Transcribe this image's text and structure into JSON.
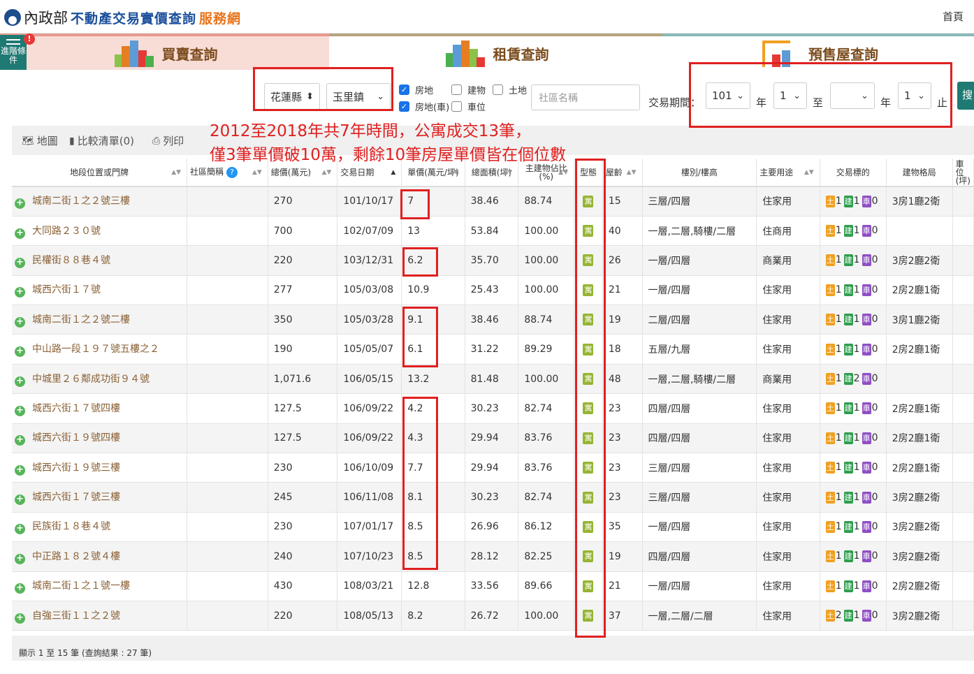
{
  "header": {
    "ministry": "內政部",
    "site_title": "不動產交易實價查詢",
    "site_suffix": "服務網",
    "home_link": "首頁"
  },
  "tabs": [
    {
      "label": "買賣查詢",
      "active": true
    },
    {
      "label": "租賃查詢",
      "active": false
    },
    {
      "label": "預售屋查詢",
      "active": false
    }
  ],
  "advanced": {
    "label": "進階條件",
    "badge": "!"
  },
  "filters": {
    "county": "花蓮縣",
    "town": "玉里鎮",
    "checkboxes": [
      {
        "label": "房地",
        "checked": true
      },
      {
        "label": "建物",
        "checked": false
      },
      {
        "label": "土地",
        "checked": false
      },
      {
        "label": "房地(車)",
        "checked": true
      },
      {
        "label": "車位",
        "checked": false
      }
    ],
    "community_placeholder": "社區名稱",
    "period_label": "交易期間：",
    "start_year": "101",
    "start_month": "1",
    "end_year": "",
    "end_month": "1",
    "year_unit": "年",
    "to_label": "至",
    "end_label": "止",
    "search_label": "搜"
  },
  "annotation": {
    "line1": "2012至2018年共7年時間，公寓成交13筆，",
    "line2": "僅3筆單價破10萬，剩餘10筆房屋單價皆在個位數"
  },
  "toolbar": {
    "map_label": "地圖",
    "compare_label": "比較清單(0)",
    "print_label": "列印"
  },
  "table": {
    "headers": [
      "地段位置或門牌",
      "社區簡稱",
      "總價(萬元)",
      "交易日期",
      "單價(萬元/坪)",
      "總面積(坪)",
      "主建物佔比(%)",
      "型態",
      "屋齡",
      "樓別/樓高",
      "主要用途",
      "交易標的",
      "建物格局",
      "車位(坪)"
    ],
    "type_tag": "寓",
    "tag_labels": {
      "land": "土",
      "building": "建",
      "car": "車"
    },
    "rows": [
      {
        "addr": "城南二街１之２號三樓",
        "price": "270",
        "date": "101/10/17",
        "unit": "7",
        "area": "38.46",
        "ratio": "88.74",
        "age": "15",
        "floor": "三層/四層",
        "use": "住家用",
        "land": "1",
        "bldg": "1",
        "car": "0",
        "layout": "3房1廳2衛"
      },
      {
        "addr": "大同路２３０號",
        "price": "700",
        "date": "102/07/09",
        "unit": "13",
        "area": "53.84",
        "ratio": "100.00",
        "age": "40",
        "floor": "一層,二層,騎樓/二層",
        "use": "住商用",
        "land": "1",
        "bldg": "1",
        "car": "0",
        "layout": ""
      },
      {
        "addr": "民權街８８巷４號",
        "price": "220",
        "date": "103/12/31",
        "unit": "6.2",
        "area": "35.70",
        "ratio": "100.00",
        "age": "26",
        "floor": "一層/四層",
        "use": "商業用",
        "land": "1",
        "bldg": "1",
        "car": "0",
        "layout": "3房2廳2衛"
      },
      {
        "addr": "城西六街１７號",
        "price": "277",
        "date": "105/03/08",
        "unit": "10.9",
        "area": "25.43",
        "ratio": "100.00",
        "age": "21",
        "floor": "一層/四層",
        "use": "住家用",
        "land": "1",
        "bldg": "1",
        "car": "0",
        "layout": "2房2廳1衛"
      },
      {
        "addr": "城南二街１之２號二樓",
        "price": "350",
        "date": "105/03/28",
        "unit": "9.1",
        "area": "38.46",
        "ratio": "88.74",
        "age": "19",
        "floor": "二層/四層",
        "use": "住家用",
        "land": "1",
        "bldg": "1",
        "car": "0",
        "layout": "3房1廳2衛"
      },
      {
        "addr": "中山路一段１９７號五樓之２",
        "price": "190",
        "date": "105/05/07",
        "unit": "6.1",
        "area": "31.22",
        "ratio": "89.29",
        "age": "18",
        "floor": "五層/九層",
        "use": "住家用",
        "land": "1",
        "bldg": "1",
        "car": "0",
        "layout": "2房2廳1衛"
      },
      {
        "addr": "中城里２６鄰成功街９４號",
        "price": "1,071.6",
        "date": "106/05/15",
        "unit": "13.2",
        "area": "81.48",
        "ratio": "100.00",
        "age": "48",
        "floor": "一層,二層,騎樓/二層",
        "use": "商業用",
        "land": "1",
        "bldg": "2",
        "car": "0",
        "layout": ""
      },
      {
        "addr": "城西六街１７號四樓",
        "price": "127.5",
        "date": "106/09/22",
        "unit": "4.2",
        "area": "30.23",
        "ratio": "82.74",
        "age": "23",
        "floor": "四層/四層",
        "use": "住家用",
        "land": "1",
        "bldg": "1",
        "car": "0",
        "layout": "2房2廳1衛"
      },
      {
        "addr": "城西六街１９號四樓",
        "price": "127.5",
        "date": "106/09/22",
        "unit": "4.3",
        "area": "29.94",
        "ratio": "83.76",
        "age": "23",
        "floor": "四層/四層",
        "use": "住家用",
        "land": "1",
        "bldg": "1",
        "car": "0",
        "layout": "2房2廳1衛"
      },
      {
        "addr": "城西六街１９號三樓",
        "price": "230",
        "date": "106/10/09",
        "unit": "7.7",
        "area": "29.94",
        "ratio": "83.76",
        "age": "23",
        "floor": "三層/四層",
        "use": "住家用",
        "land": "1",
        "bldg": "1",
        "car": "0",
        "layout": "2房2廳1衛"
      },
      {
        "addr": "城西六街１７號三樓",
        "price": "245",
        "date": "106/11/08",
        "unit": "8.1",
        "area": "30.23",
        "ratio": "82.74",
        "age": "23",
        "floor": "三層/四層",
        "use": "住家用",
        "land": "1",
        "bldg": "1",
        "car": "0",
        "layout": "3房2廳2衛"
      },
      {
        "addr": "民族街１８巷４號",
        "price": "230",
        "date": "107/01/17",
        "unit": "8.5",
        "area": "26.96",
        "ratio": "86.12",
        "age": "35",
        "floor": "一層/四層",
        "use": "住家用",
        "land": "1",
        "bldg": "1",
        "car": "0",
        "layout": "3房2廳2衛"
      },
      {
        "addr": "中正路１８２號４樓",
        "price": "240",
        "date": "107/10/23",
        "unit": "8.5",
        "area": "28.12",
        "ratio": "82.25",
        "age": "19",
        "floor": "四層/四層",
        "use": "住家用",
        "land": "1",
        "bldg": "1",
        "car": "0",
        "layout": "3房2廳2衛"
      },
      {
        "addr": "城南二街１之１號一樓",
        "price": "430",
        "date": "108/03/21",
        "unit": "12.8",
        "area": "33.56",
        "ratio": "89.66",
        "age": "21",
        "floor": "一層/四層",
        "use": "住家用",
        "land": "1",
        "bldg": "1",
        "car": "0",
        "layout": "2房2廳2衛"
      },
      {
        "addr": "自強三街１１之２號",
        "price": "220",
        "date": "108/05/13",
        "unit": "8.2",
        "area": "26.72",
        "ratio": "100.00",
        "age": "37",
        "floor": "一層,二層/二層",
        "use": "住家用",
        "land": "2",
        "bldg": "1",
        "car": "0",
        "layout": "3房2廳2衛"
      }
    ]
  },
  "footer": {
    "summary": "顯示 1 至 15 筆 (查詢結果 : 27 筆)"
  }
}
